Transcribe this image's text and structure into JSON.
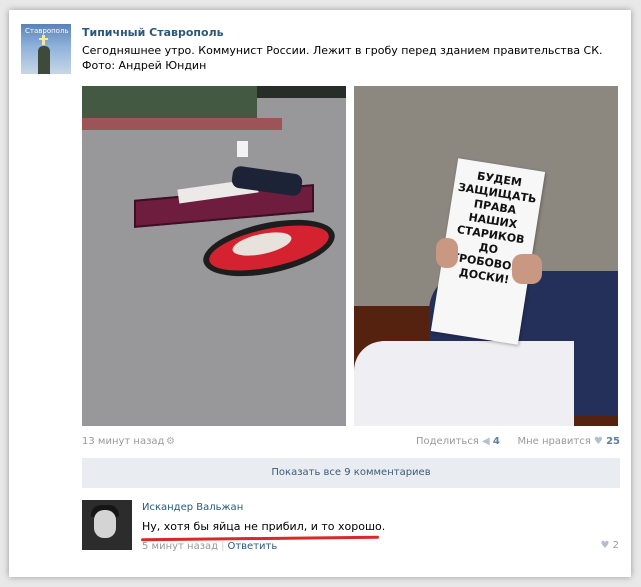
{
  "post": {
    "author": "Типичный Ставрополь",
    "avatar_text": "Ставрополь",
    "text_line1": "Сегодняшнее утро. Коммунист России. Лежит в гробу перед зданием правительства СК.",
    "text_line2": "Фото: Андрей Юндин",
    "photo_sign_text": "БУДЕМ\nЗАЩИЩАТЬ\nПРАВА\nНАШИХ\nСТАРИКОВ\nДО\nГРОБОВОЙ\nДОСКИ!",
    "time": "13 минут назад",
    "share_label": "Поделиться",
    "share_count": "4",
    "like_label": "Мне нравится",
    "like_count": "25",
    "show_comments": "Показать все 9 комментариев"
  },
  "comment": {
    "author": "Искандер Вальжан",
    "text": "Ну, хотя бы яйца не прибил, и то хорошо.",
    "time": "5 минут назад",
    "reply_label": "Ответить",
    "likes": "2"
  },
  "icons": {
    "android": "android-icon",
    "share": "megaphone-icon",
    "like": "heart-icon"
  },
  "colors": {
    "link": "#2b587a",
    "meta": "#999999",
    "panel": "#e9edf1",
    "underline": "#d8282a"
  }
}
